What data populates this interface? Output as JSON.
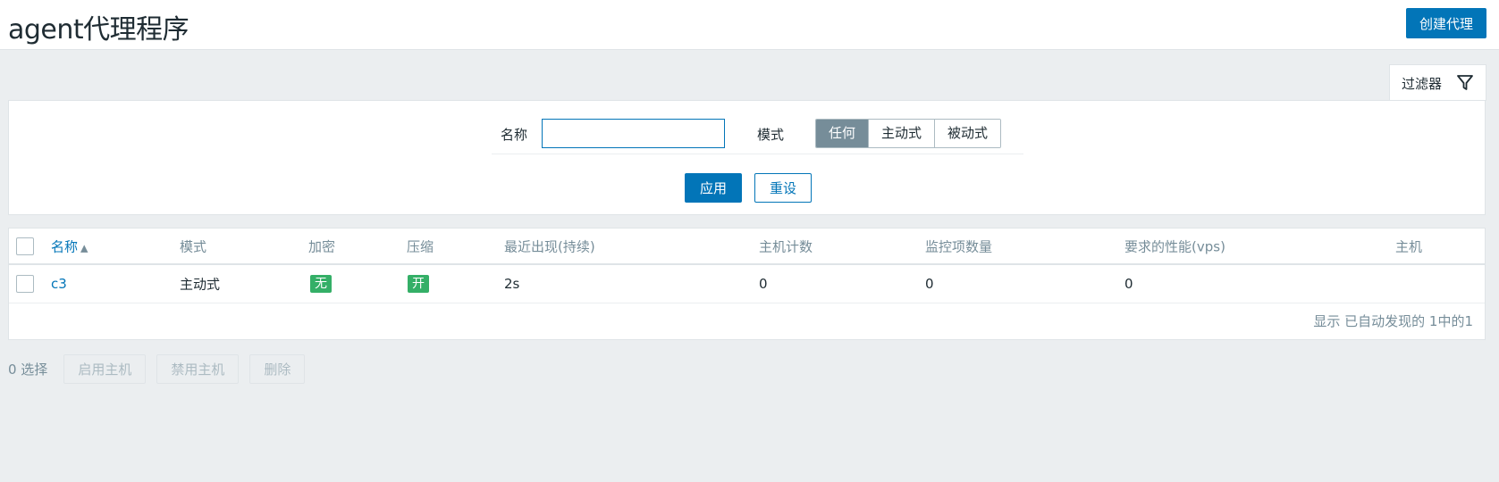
{
  "header": {
    "title": "agent代理程序",
    "create_button": "创建代理"
  },
  "filter": {
    "tab_label": "过滤器",
    "name_label": "名称",
    "name_value": "",
    "mode_label": "模式",
    "mode_options": [
      "任何",
      "主动式",
      "被动式"
    ],
    "mode_selected": "任何",
    "apply_button": "应用",
    "reset_button": "重设"
  },
  "table": {
    "columns": [
      "名称",
      "模式",
      "加密",
      "压缩",
      "最近出现(持续)",
      "主机计数",
      "监控项数量",
      "要求的性能(vps)",
      "主机"
    ],
    "sort_arrow": "▲",
    "rows": [
      {
        "name": "c3",
        "mode": "主动式",
        "encryption": "无",
        "compression": "开",
        "last_seen": "2s",
        "host_count": "0",
        "item_count": "0",
        "required_vps": "0",
        "hosts": ""
      }
    ],
    "paging_text": "显示 已自动发现的 1中的1"
  },
  "actions": {
    "selected_count": "0 选择",
    "enable_button": "启用主机",
    "disable_button": "禁用主机",
    "delete_button": "删除"
  },
  "colors": {
    "primary": "#0275b8",
    "badge_green": "#34af67",
    "segment_active": "#768d99",
    "background": "#ebeef0"
  }
}
